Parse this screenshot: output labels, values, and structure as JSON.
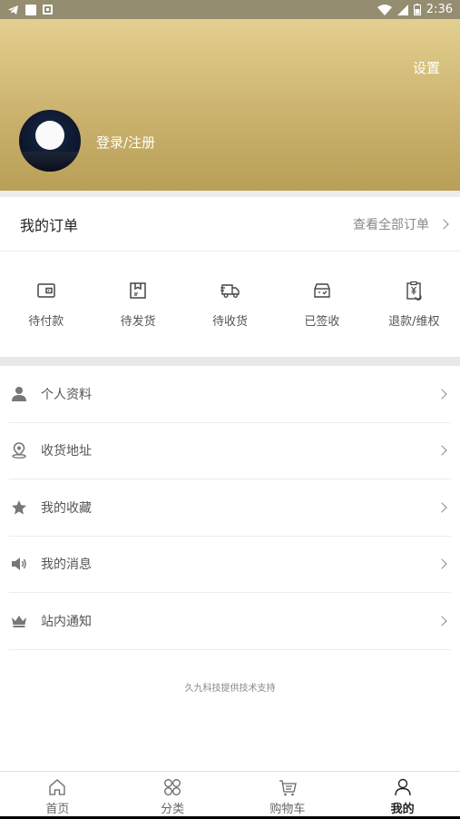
{
  "status_bar": {
    "time": "2:36"
  },
  "header": {
    "settings_label": "设置",
    "login_label": "登录/注册"
  },
  "orders": {
    "title": "我的订单",
    "view_all": "查看全部订单",
    "items": [
      {
        "label": "待付款",
        "icon": "wallet-icon"
      },
      {
        "label": "待发货",
        "icon": "package-icon"
      },
      {
        "label": "待收货",
        "icon": "truck-icon"
      },
      {
        "label": "已签收",
        "icon": "signed-box-icon"
      },
      {
        "label": "退款/维权",
        "icon": "refund-clipboard-icon"
      }
    ]
  },
  "menu": {
    "items": [
      {
        "label": "个人资料",
        "icon": "person-icon"
      },
      {
        "label": "收货地址",
        "icon": "location-pin-icon"
      },
      {
        "label": "我的收藏",
        "icon": "star-icon"
      },
      {
        "label": "我的消息",
        "icon": "speaker-icon"
      },
      {
        "label": "站内通知",
        "icon": "crown-icon"
      }
    ],
    "footer": "久九科技提供技术支持"
  },
  "tabbar": {
    "items": [
      {
        "label": "首页",
        "icon": "home-icon"
      },
      {
        "label": "分类",
        "icon": "category-icon"
      },
      {
        "label": "购物车",
        "icon": "cart-icon"
      },
      {
        "label": "我的",
        "icon": "user-icon",
        "active": true
      }
    ]
  },
  "colors": {
    "header_top": "#e3cf8f",
    "header_bottom": "#b99f57",
    "icon_gray": "#555555"
  }
}
